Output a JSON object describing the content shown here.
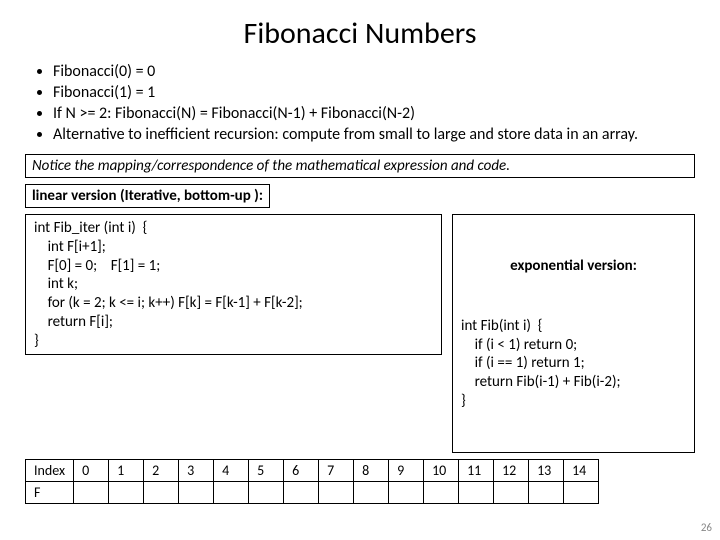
{
  "title": "Fibonacci Numbers",
  "bullets": {
    "b0": "Fibonacci(0) = 0",
    "b1": "Fibonacci(1) = 1",
    "b2": "If N >= 2:        Fibonacci(N) = Fibonacci(N-1) + Fibonacci(N-2)",
    "b3": "Alternative to inefficient recursion:  compute from small to large and store data in an array."
  },
  "notice": "Notice the mapping/correspondence of the mathematical expression and code.",
  "linear_heading": {
    "pre": "linear ",
    "bold": "version (Iterative, bottom-up ):"
  },
  "code_linear": "int Fib_iter (int i)  {\n    int F[i+1];\n    F[0] = 0;    F[1] = 1;\n    int k;\n    for (k = 2; k <= i; k++) F[k] = F[k-1] + F[k-2];\n    return F[i];\n}",
  "exp_heading": "exponential version:",
  "code_exp": "int Fib(int i)  {\n    if (i < 1) return 0;\n    if (i == 1) return 1;\n    return Fib(i-1) + Fib(i-2);\n}",
  "table": {
    "row_label_index": "Index",
    "row_label_f": "F",
    "cols": [
      "0",
      "1",
      "2",
      "3",
      "4",
      "5",
      "6",
      "7",
      "8",
      "9",
      "10",
      "11",
      "12",
      "13",
      "14"
    ]
  },
  "slide_number": "26"
}
